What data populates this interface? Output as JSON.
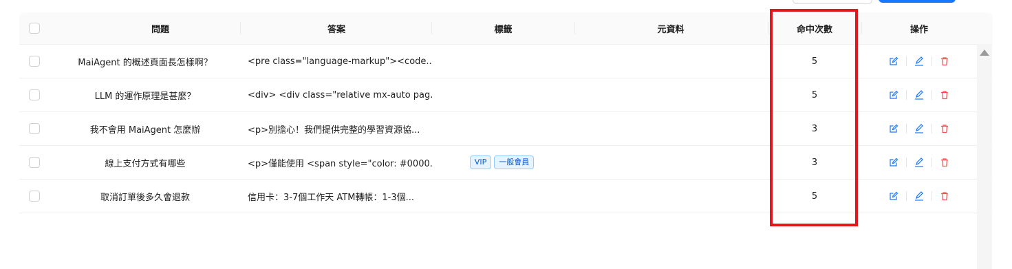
{
  "colors": {
    "primary": "#1677ff",
    "edit_icon": "#1677ff",
    "delete_icon": "#ff4d4f",
    "highlight": "#e0171f",
    "tag_border": "#91caff",
    "tag_text": "#0958d9"
  },
  "table": {
    "headers": {
      "question": "問題",
      "answer": "答案",
      "tags": "標籤",
      "metadata": "元資料",
      "hits": "命中次數",
      "actions": "操作"
    },
    "rows": [
      {
        "question": "MaiAgent 的概述頁面長怎樣啊？",
        "answer": "<pre class=\"language-markup\"><code...",
        "tags": [],
        "metadata": "",
        "hits": "5"
      },
      {
        "question": "LLM 的運作原理是甚麼？",
        "answer": "<div> <div class=\"relative mx-auto pag...",
        "tags": [],
        "metadata": "",
        "hits": "5"
      },
      {
        "question": "我不會用 MaiAgent 怎麼辦",
        "answer": "<p>別擔心！我們提供完整的學習資源協...",
        "tags": [],
        "metadata": "",
        "hits": "3"
      },
      {
        "question": "線上支付方式有哪些",
        "answer": "<p>僅能使用 <span style=\"color: #0000...",
        "tags": [
          "VIP",
          "一般會員"
        ],
        "metadata": "",
        "hits": "3"
      },
      {
        "question": "取消訂單後多久會退款",
        "answer": "信用卡：3-7個工作天 ATM轉帳：1-3個...",
        "tags": [],
        "metadata": "",
        "hits": "5"
      }
    ],
    "action_icons": [
      "open-edit-icon",
      "pencil-icon",
      "trash-icon"
    ]
  }
}
